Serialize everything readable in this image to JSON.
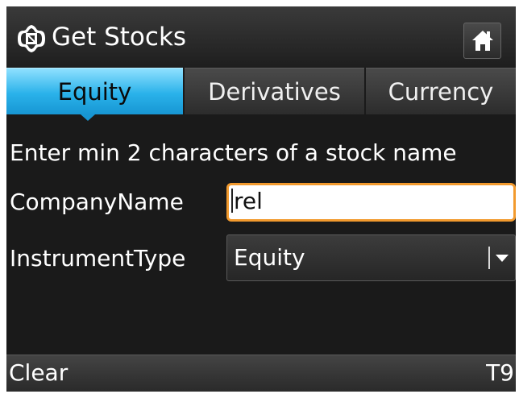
{
  "titlebar": {
    "title": "Get Stocks",
    "logo_icon": "app-logo-icon",
    "home_icon": "home-icon"
  },
  "tabs": [
    {
      "label": "Equity",
      "active": true
    },
    {
      "label": "Derivatives",
      "active": false
    },
    {
      "label": "Currency",
      "active": false
    }
  ],
  "form": {
    "hint": "Enter min 2 characters of a stock name",
    "company_label": "CompanyName",
    "company_value": "rel",
    "instrument_label": "InstrumentType",
    "instrument_value": "Equity"
  },
  "softkeys": {
    "left": "Clear",
    "right": "T9"
  },
  "colors": {
    "active_tab": "#2ab2ea",
    "input_focus_border": "#f29a2e",
    "background": "#1a1a1a"
  }
}
